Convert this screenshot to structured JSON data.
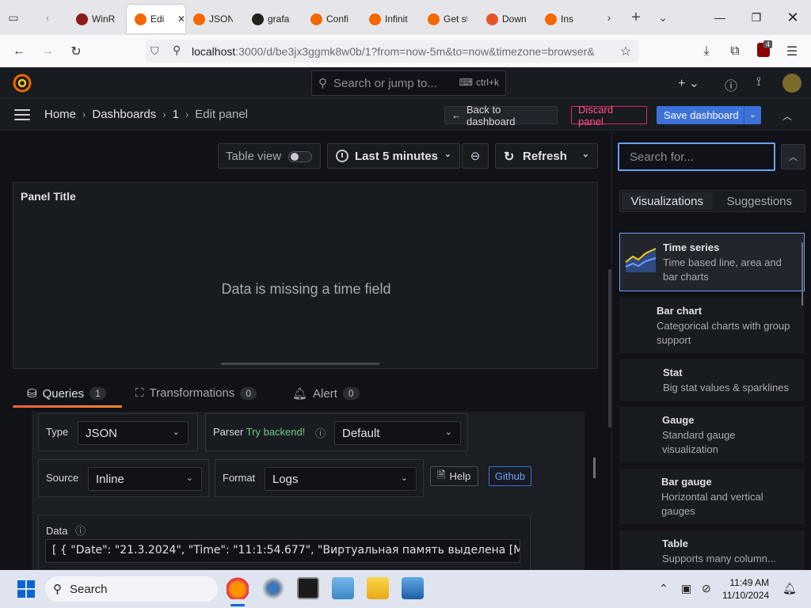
{
  "browser": {
    "tabs": [
      {
        "label": "WinR",
        "color": "#8b1a1a"
      },
      {
        "label": "Edi",
        "color": "#f46800",
        "active": true
      },
      {
        "label": "JSON",
        "color": "#f46800"
      },
      {
        "label": "grafa",
        "color": "#222222"
      },
      {
        "label": "Confi",
        "color": "#f46800"
      },
      {
        "label": "Infinit",
        "color": "#f46800"
      },
      {
        "label": "Get st",
        "color": "#f46800"
      },
      {
        "label": "Down",
        "color": "#e8542a"
      },
      {
        "label": "Ins",
        "color": "#f46800"
      }
    ],
    "url_host": "localhost",
    "url_rest": ":3000/d/be3jx3ggmk8w0b/1?from=now-5m&to=now&timezone=browser&",
    "extension_badge": "4"
  },
  "grafana": {
    "search_placeholder": "Search or jump to...",
    "search_shortcut": "ctrl+k",
    "breadcrumbs": [
      "Home",
      "Dashboards",
      "1",
      "Edit panel"
    ],
    "back_label": "Back to dashboard",
    "discard_label": "Discard panel",
    "save_label": "Save dashboard"
  },
  "toolbar": {
    "table_view_label": "Table view",
    "time_range": "Last 5 minutes",
    "refresh_label": "Refresh"
  },
  "panel": {
    "title": "Panel Title",
    "message": "Data is missing a time field"
  },
  "query_tabs": [
    {
      "label": "Queries",
      "count": "1"
    },
    {
      "label": "Transformations",
      "count": "0"
    },
    {
      "label": "Alert",
      "count": "0"
    }
  ],
  "query": {
    "type_label": "Type",
    "type_value": "JSON",
    "parser_label": "Parser",
    "parser_hint": "Try backend!",
    "parser_value": "Default",
    "source_label": "Source",
    "source_value": "Inline",
    "format_label": "Format",
    "format_value": "Logs",
    "help_label": "Help",
    "github_label": "Github",
    "data_label": "Data",
    "data_value": "[ { \"Date\": \"21.3.2024\", \"Time\": \"11:1:54.677\", \"Виртуальная память выделена [МБ]\": ..."
  },
  "viz_picker": {
    "search_placeholder": "Search for...",
    "tabs": [
      "Visualizations",
      "Suggestions"
    ],
    "items": [
      {
        "title": "Time series",
        "desc": "Time based line, area and bar charts"
      },
      {
        "title": "Bar chart",
        "desc": "Categorical charts with group support"
      },
      {
        "title": "Stat",
        "desc": "Big stat values & sparklines"
      },
      {
        "title": "Gauge",
        "desc": "Standard gauge visualization"
      },
      {
        "title": "Bar gauge",
        "desc": "Horizontal and vertical gauges"
      },
      {
        "title": "Table",
        "desc": "Supports many column..."
      }
    ]
  },
  "taskbar": {
    "search_label": "Search",
    "time": "11:49 AM",
    "date": "11/10/2024"
  }
}
